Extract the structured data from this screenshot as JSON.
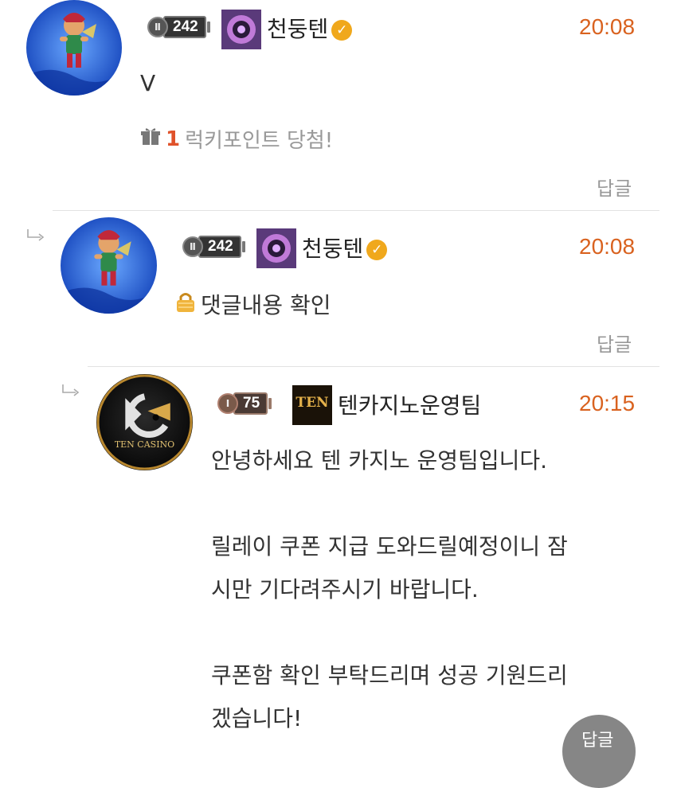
{
  "comments": [
    {
      "level": "242",
      "username": "천둥텐",
      "time": "20:08",
      "content": "V",
      "lucky_count": "1",
      "lucky_text": "럭키포인트 당첨!",
      "reply_label": "답글"
    },
    {
      "level": "242",
      "username": "천둥텐",
      "time": "20:08",
      "content": "댓글내용 확인",
      "reply_label": "답글"
    },
    {
      "level": "75",
      "rank_label": "TEN",
      "avatar_text": "TEN CASINO",
      "username": "텐카지노운영팀",
      "time": "20:15",
      "content": "안녕하세요 텐 카지노 운영팀입니다.\n\n릴레이 쿠폰 지급 도와드릴예정이니 잠\n시만 기다려주시기 바랍니다.\n\n쿠폰함 확인 부탁드리며 성공 기원드리\n겠습니다!",
      "reply_label": "답글"
    }
  ],
  "colors": {
    "time": "#d9621f",
    "lucky_number": "#e0522a",
    "verified": "#f0a81c",
    "lock": "#f0b43c"
  },
  "icons": {
    "gift": "gift-icon",
    "lock": "lock-icon",
    "verified": "verified-check-icon",
    "reply_arrow": "reply-arrow-icon"
  }
}
